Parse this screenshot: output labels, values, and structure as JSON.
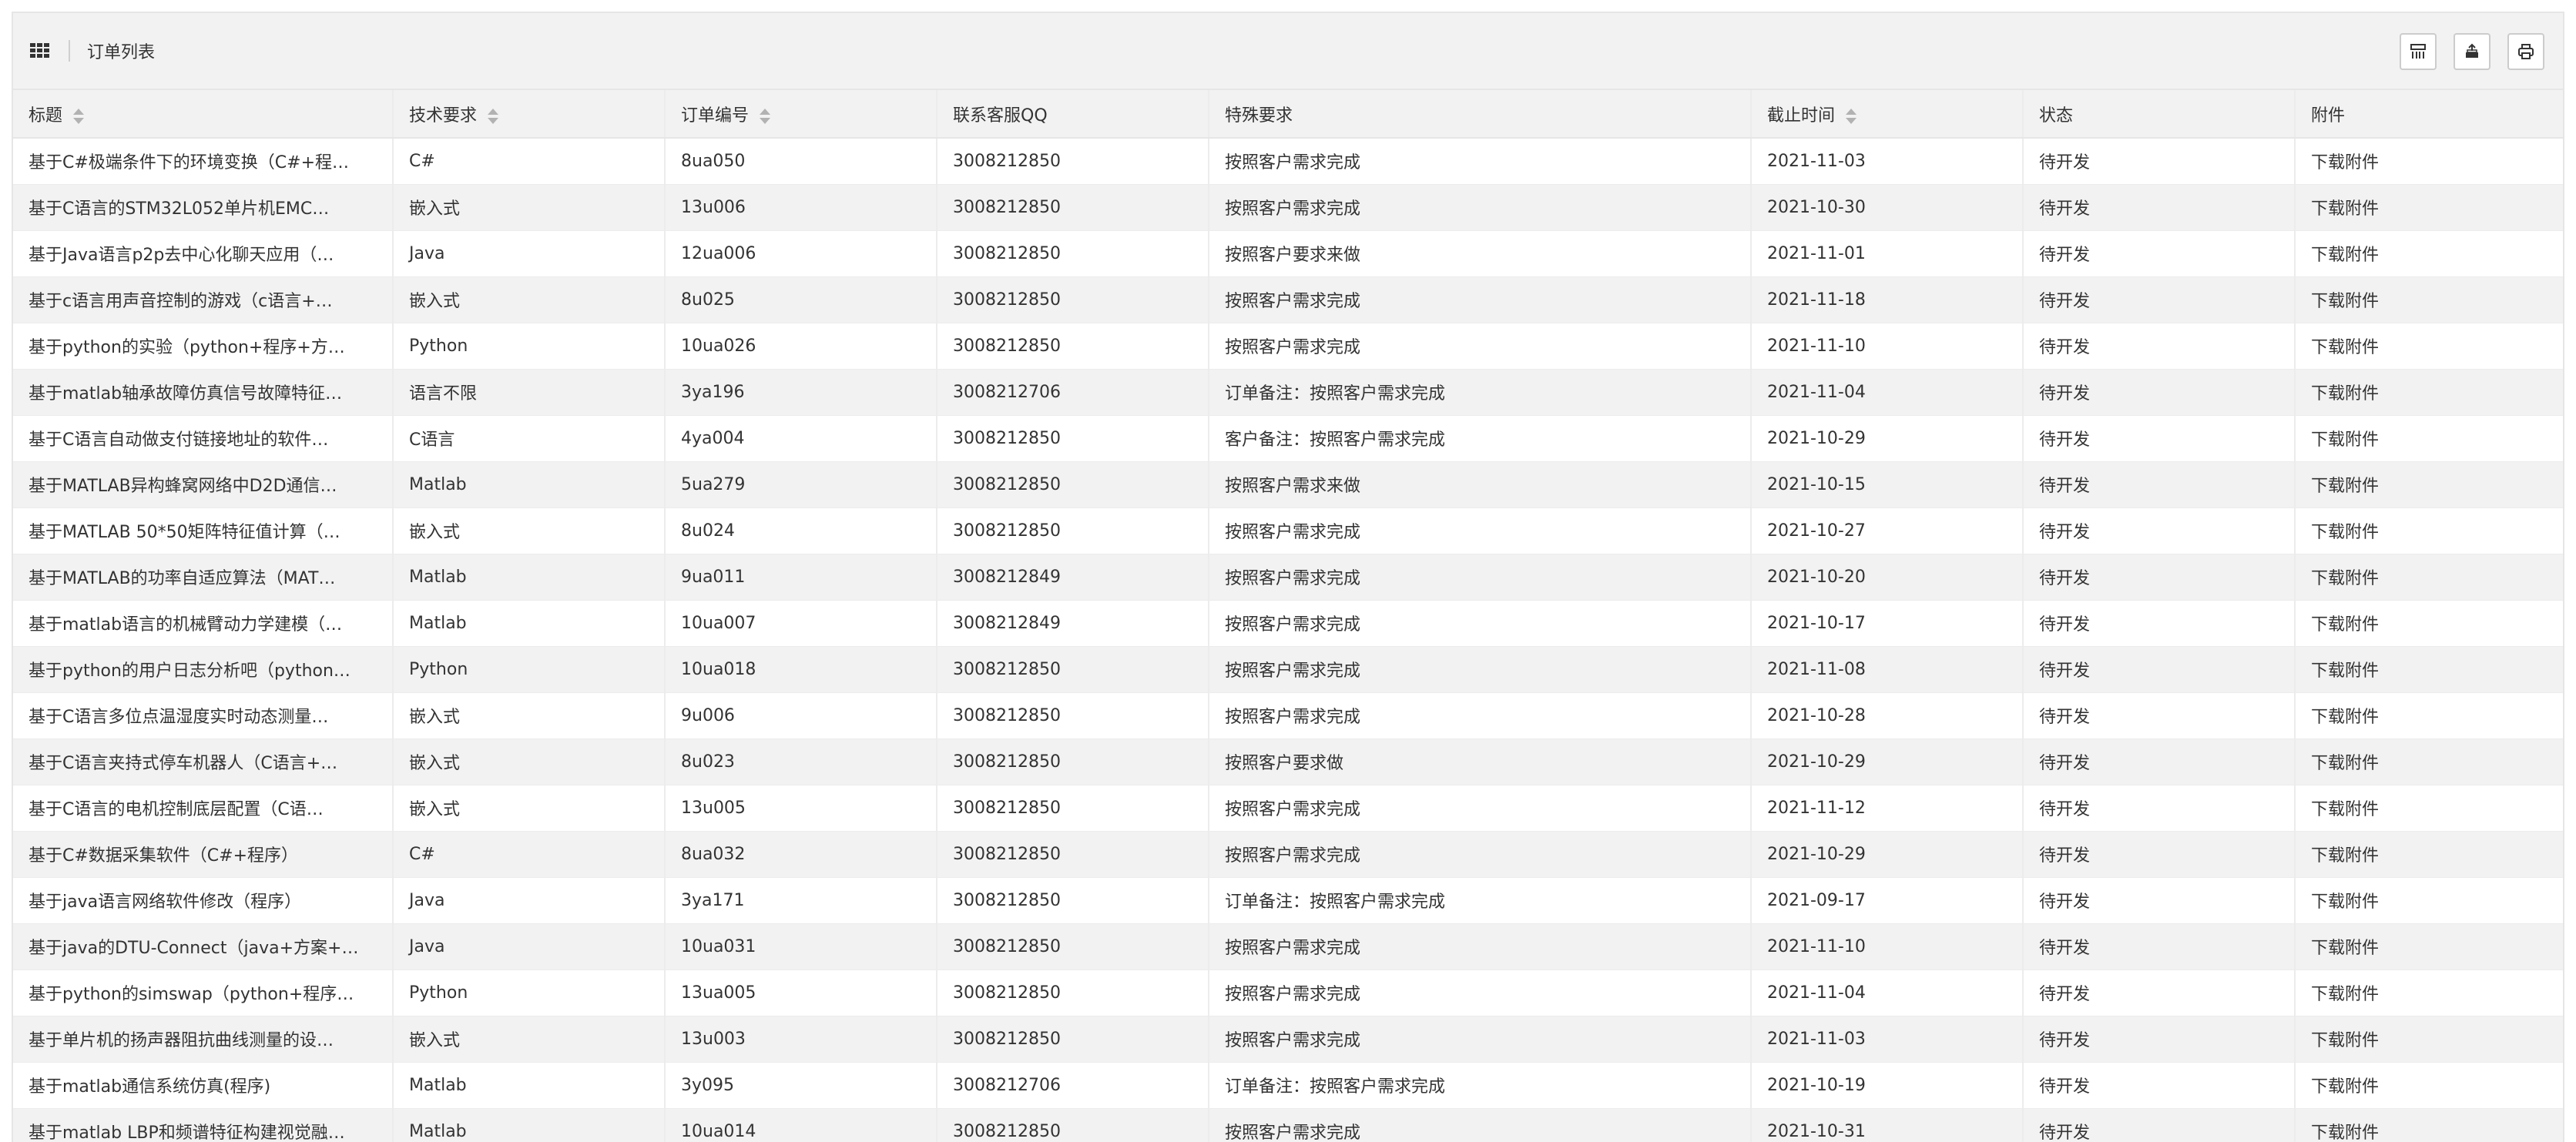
{
  "header": {
    "title": "订单列表"
  },
  "toolbar": {
    "icons": [
      "columns-icon",
      "export-icon",
      "print-icon"
    ]
  },
  "table": {
    "columns": [
      "标题",
      "技术要求",
      "订单编号",
      "联系客服QQ",
      "特殊要求",
      "截止时间",
      "状态",
      "附件"
    ],
    "sortable": [
      true,
      true,
      true,
      false,
      false,
      true,
      false,
      false
    ],
    "rows": [
      [
        "基于C#极端条件下的环境变换（C#+程…",
        "C#",
        "8ua050",
        "3008212850",
        "按照客户需求完成",
        "2021-11-03",
        "待开发",
        "下载附件"
      ],
      [
        "基于C语言的STM32L052单片机EMC…",
        "嵌入式",
        "13u006",
        "3008212850",
        "按照客户需求完成",
        "2021-10-30",
        "待开发",
        "下载附件"
      ],
      [
        "基于Java语言p2p去中心化聊天应用（…",
        "Java",
        "12ua006",
        "3008212850",
        "按照客户要求来做",
        "2021-11-01",
        "待开发",
        "下载附件"
      ],
      [
        "基于c语言用声音控制的游戏（c语言+…",
        "嵌入式",
        "8u025",
        "3008212850",
        "按照客户需求完成",
        "2021-11-18",
        "待开发",
        "下载附件"
      ],
      [
        "基于python的实验（python+程序+方…",
        "Python",
        "10ua026",
        "3008212850",
        "按照客户需求完成",
        "2021-11-10",
        "待开发",
        "下载附件"
      ],
      [
        "基于matlab轴承故障仿真信号故障特征…",
        "语言不限",
        "3ya196",
        "3008212706",
        "订单备注：按照客户需求完成",
        "2021-11-04",
        "待开发",
        "下载附件"
      ],
      [
        "基于C语言自动做支付链接地址的软件…",
        "C语言",
        "4ya004",
        "3008212850",
        "客户备注：按照客户需求完成",
        "2021-10-29",
        "待开发",
        "下载附件"
      ],
      [
        "基于MATLAB异构蜂窝网络中D2D通信…",
        "Matlab",
        "5ua279",
        "3008212850",
        "按照客户需求来做",
        "2021-10-15",
        "待开发",
        "下载附件"
      ],
      [
        "基于MATLAB 50*50矩阵特征值计算（…",
        "嵌入式",
        "8u024",
        "3008212850",
        "按照客户需求完成",
        "2021-10-27",
        "待开发",
        "下载附件"
      ],
      [
        "基于MATLAB的功率自适应算法（MAT…",
        "Matlab",
        "9ua011",
        "3008212849",
        "按照客户需求完成",
        "2021-10-20",
        "待开发",
        "下载附件"
      ],
      [
        "基于matlab语言的机械臂动力学建模（…",
        "Matlab",
        "10ua007",
        "3008212849",
        "按照客户需求完成",
        "2021-10-17",
        "待开发",
        "下载附件"
      ],
      [
        "基于python的用户日志分析吧（python…",
        "Python",
        "10ua018",
        "3008212850",
        "按照客户需求完成",
        "2021-11-08",
        "待开发",
        "下载附件"
      ],
      [
        "基于C语言多位点温湿度实时动态测量…",
        "嵌入式",
        "9u006",
        "3008212850",
        "按照客户需求完成",
        "2021-10-28",
        "待开发",
        "下载附件"
      ],
      [
        "基于C语言夹持式停车机器人（C语言+…",
        "嵌入式",
        "8u023",
        "3008212850",
        "按照客户要求做",
        "2021-10-29",
        "待开发",
        "下载附件"
      ],
      [
        "基于C语言的电机控制底层配置（C语…",
        "嵌入式",
        "13u005",
        "3008212850",
        "按照客户需求完成",
        "2021-11-12",
        "待开发",
        "下载附件"
      ],
      [
        "基于C#数据采集软件（C#+程序）",
        "C#",
        "8ua032",
        "3008212850",
        "按照客户需求完成",
        "2021-10-29",
        "待开发",
        "下载附件"
      ],
      [
        "基于java语言网络软件修改（程序）",
        "Java",
        "3ya171",
        "3008212850",
        "订单备注：按照客户需求完成",
        "2021-09-17",
        "待开发",
        "下载附件"
      ],
      [
        "基于java的DTU-Connect（java+方案+…",
        "Java",
        "10ua031",
        "3008212850",
        "按照客户需求完成",
        "2021-11-10",
        "待开发",
        "下载附件"
      ],
      [
        "基于python的simswap（python+程序…",
        "Python",
        "13ua005",
        "3008212850",
        "按照客户需求完成",
        "2021-11-04",
        "待开发",
        "下载附件"
      ],
      [
        "基于单片机的扬声器阻抗曲线测量的设…",
        "嵌入式",
        "13u003",
        "3008212850",
        "按照客户需求完成",
        "2021-11-03",
        "待开发",
        "下载附件"
      ],
      [
        "基于matlab通信系统仿真(程序)",
        "Matlab",
        "3y095",
        "3008212706",
        "订单备注：按照客户需求完成",
        "2021-10-19",
        "待开发",
        "下载附件"
      ],
      [
        "基于matlab LBP和频谱特征构建视觉融…",
        "Matlab",
        "10ua014",
        "3008212850",
        "按照客户需求完成",
        "2021-10-31",
        "待开发",
        "下载附件"
      ]
    ]
  }
}
